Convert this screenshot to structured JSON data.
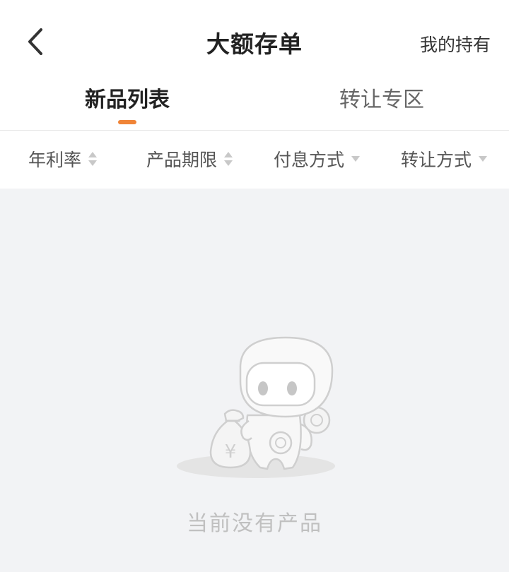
{
  "header": {
    "title": "大额存单",
    "right_link": "我的持有",
    "back_icon": "chevron-left-icon"
  },
  "tabs": [
    {
      "label": "新品列表",
      "active": true
    },
    {
      "label": "转让专区",
      "active": false
    }
  ],
  "filters": [
    {
      "label": "年利率",
      "icon": "sort-up-down-icon"
    },
    {
      "label": "产品期限",
      "icon": "sort-up-down-icon"
    },
    {
      "label": "付息方式",
      "icon": "caret-down-icon"
    },
    {
      "label": "转让方式",
      "icon": "caret-down-icon"
    }
  ],
  "empty_state": {
    "message": "当前没有产品",
    "illustration": "robot-with-money-bag-icon",
    "money_symbol": "¥"
  },
  "colors": {
    "accent": "#f08437",
    "background": "#f2f3f5",
    "surface": "#ffffff",
    "muted_text": "#c0c0c0"
  }
}
